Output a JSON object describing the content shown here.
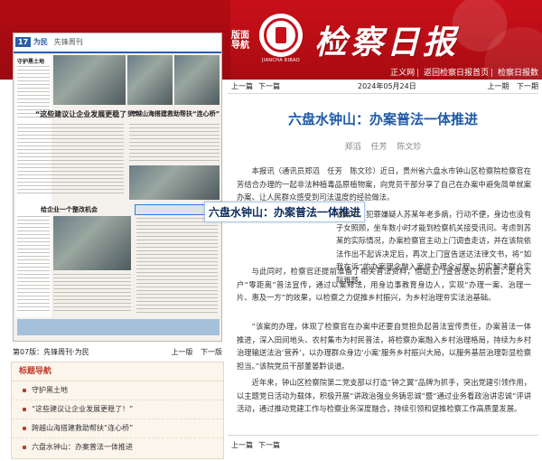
{
  "header": {
    "section_tag": "版面导航",
    "logo_caption": "JIANCHA RIBAO",
    "masthead": "检察日报",
    "links": [
      "正义网",
      "返回检察日报首页",
      "检察日报数"
    ]
  },
  "thumbnail": {
    "page_label": "17",
    "section": "为民",
    "column_name": "先锋周刊",
    "headlines": [
      "“这些建议让企业发展更稳了！”",
      "跨越山海搭建救助帮扶“连心桥”",
      "六盘水钟山：办案普法一体推进",
      "给企业一个整改机会",
      "守护黑土地"
    ],
    "callout_title": "六盘水钟山：办案普法一体推进"
  },
  "page_bar": {
    "title": "第07版：先锋周刊·为民",
    "prev": "上一版",
    "next": "下一版"
  },
  "index": {
    "heading": "标题导航",
    "items": [
      "守护黑土地",
      "“这些建议让企业发展更稳了！”",
      "跨越山海搭建救助帮扶“连心桥”",
      "六盘水钟山：办案普法一体推进"
    ]
  },
  "article": {
    "prev": "上一篇",
    "next": "下一篇",
    "date": "2024年05月24日",
    "prev_page": "上一期",
    "next_page": "下一期",
    "title": "六盘水钟山：办案普法一体推进",
    "authors": [
      "郑滔",
      "任芳",
      "陈文珍"
    ],
    "paragraphs": [
      "本报讯（通讯员郑滔　任芳　陈文珍）近日，贵州省六盘水市钟山区检察院检察官在芳结合办理的一起非法种植毒品原植物案，向党员干部分享了自己在办案中避免简单就案办案、让人民群众感受到司法温度的经验做法。",
      "该案中，犯罪嫌疑人苏某年老多病，行动不便，身边也没有子女照顾，坐车数小时才能到检察机关接受讯问。考虑到苏某的实际情况，办案检察官主动上门调查走访，并在该院依法作出不起诉决定后，再次上门宣告送达法律文书，将“如我在诉”的办案理念融入案件办理全过程，切实解决群众实际难题。",
      "与此同时，检察官还提前准备了相关普法资料，借助上门宣告送达的机会，走村入户“零距离”普法宣传，通过以案释法，用身边事教育身边人，实现“办理一案、治理一片、惠及一方”的效果，以检察之力促推乡村振兴，为乡村治理夯实法治基础。",
      "“该案的办理，体现了检察官在办案中还要自觉担负起普法宣传责任，办案普法一体推进，深入田间地头、农村集市为村民普法，将检察办案融入乡村治理格局，持续为乡村治理输送法治‘营养’，以办理群众身边‘小案’服务乡村振兴大局，以服务基层治理彰显检察担当。”该院党员干部董晏黔谈道。",
      "近年来，钟山区检察院第二党支部以打造“钟之翼”品牌为抓手，突出党建引领作用，以主题党日活动为载体，积极开展“讲政治强业务铸忠诚”暨“通过业务看政治讲忠诚”评讲活动，通过推动党建工作与检察业务深度融合，持续引领和促推检察工作高质量发展。"
    ]
  }
}
